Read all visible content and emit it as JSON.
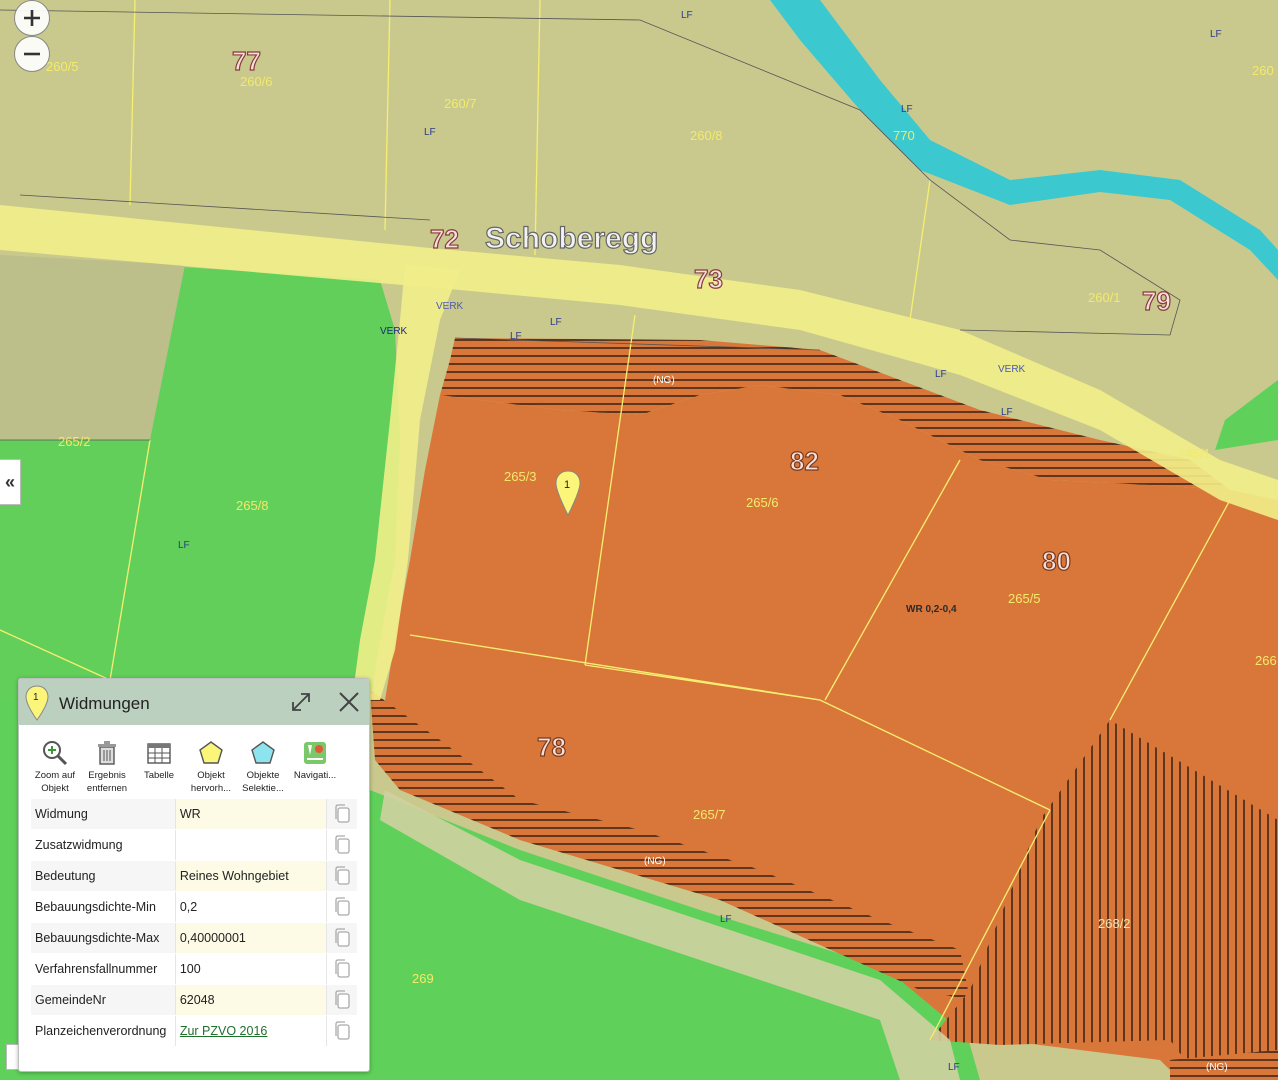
{
  "map": {
    "street_name": "Schoberegg",
    "house_numbers": [
      "77",
      "72",
      "73",
      "79",
      "82",
      "80",
      "78"
    ],
    "parcels": [
      "260/5",
      "260/6",
      "260/7",
      "260/8",
      "260/1",
      "265/2",
      "265/8",
      "265/3",
      "265/6",
      "265/5",
      "265/7",
      "745/1",
      "269",
      "266",
      "260",
      "268/2"
    ],
    "zones": [
      "LF",
      "VERK",
      "(NG)",
      "WR 0,2-0,4",
      "770"
    ],
    "marker_label": "1"
  },
  "controls": {
    "zoom_in_icon": "plus-icon",
    "zoom_out_icon": "minus-icon",
    "collapse_label": "«"
  },
  "panel": {
    "title": "Widmungen",
    "marker_label": "1",
    "tools": [
      {
        "label": "Zoom auf\nObjekt",
        "icon": "zoom-icon"
      },
      {
        "label": "Ergebnis\nentfernen",
        "icon": "trash-icon"
      },
      {
        "label": "Tabelle",
        "icon": "table-icon"
      },
      {
        "label": "Objekt\nhervorh...",
        "icon": "highlight-icon"
      },
      {
        "label": "Objekte\nSelektie...",
        "icon": "select-icon"
      },
      {
        "label": "Navigati...",
        "icon": "navigation-icon"
      }
    ],
    "rows": [
      {
        "key": "Widmung",
        "value": "WR"
      },
      {
        "key": "Zusatzwidmung",
        "value": ""
      },
      {
        "key": "Bedeutung",
        "value": "Reines Wohngebiet"
      },
      {
        "key": "Bebauungsdichte-Min",
        "value": "0,2"
      },
      {
        "key": "Bebauungsdichte-Max",
        "value": "0,40000001"
      },
      {
        "key": "Verfahrensfallnummer",
        "value": "100"
      },
      {
        "key": "GemeindeNr",
        "value": "62048"
      },
      {
        "key": "Planzeichenverordnung",
        "value": "Zur PZVO 2016"
      }
    ]
  },
  "colors": {
    "green_zone": "#5fd15a",
    "orange_zone": "#d9773a",
    "olive_zone": "#c9c98e",
    "road": "#f1ee8a",
    "river": "#3cc8cf"
  }
}
